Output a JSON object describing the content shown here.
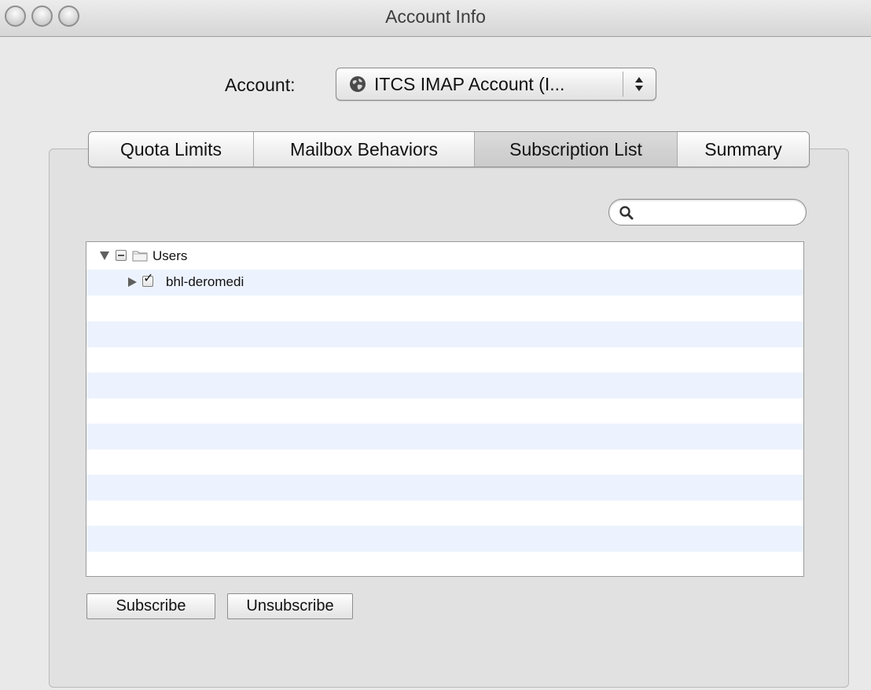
{
  "window": {
    "title": "Account Info"
  },
  "account": {
    "label": "Account:",
    "selected": "ITCS IMAP Account (I...",
    "icon": "globe-icon"
  },
  "tabs": [
    {
      "label": "Quota Limits",
      "selected": false
    },
    {
      "label": "Mailbox Behaviors",
      "selected": false
    },
    {
      "label": "Subscription List",
      "selected": true
    },
    {
      "label": "Summary",
      "selected": false
    }
  ],
  "search": {
    "value": "",
    "placeholder": "",
    "icon": "magnifier-icon"
  },
  "tree": {
    "items": [
      {
        "label": "Users",
        "expanded": true,
        "checked": "mixed",
        "icon": "folder-icon"
      },
      {
        "label": "bhl-deromedi",
        "expanded": false,
        "checked": true
      }
    ]
  },
  "buttons": {
    "subscribe": "Subscribe",
    "unsubscribe": "Unsubscribe"
  },
  "colors": {
    "alt_row": "#edf3fe",
    "window_bg": "#e9e9e9"
  }
}
